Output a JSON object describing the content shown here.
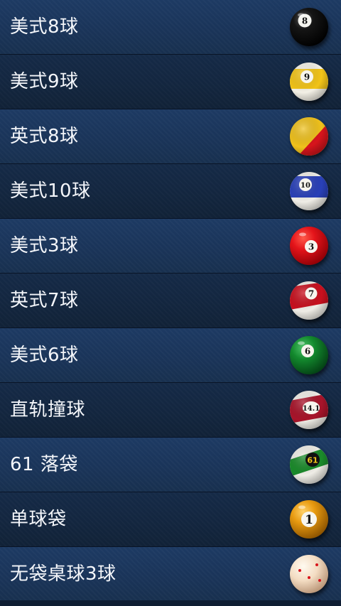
{
  "game_list": [
    {
      "label": "美式8球",
      "icon": "eight-ball-icon"
    },
    {
      "label": "美式9球",
      "icon": "nine-ball-icon"
    },
    {
      "label": "英式8球",
      "icon": "english-eight-ball-icon"
    },
    {
      "label": "美式10球",
      "icon": "ten-ball-icon"
    },
    {
      "label": "美式3球",
      "icon": "three-ball-icon"
    },
    {
      "label": "英式7球",
      "icon": "seven-ball-icon"
    },
    {
      "label": "美式6球",
      "icon": "six-ball-icon"
    },
    {
      "label": "直轨撞球",
      "icon": "straight-pool-ball-icon"
    },
    {
      "label": "61 落袋",
      "icon": "sixty-one-ball-icon"
    },
    {
      "label": "单球袋",
      "icon": "one-pocket-ball-icon"
    },
    {
      "label": "无袋桌球3球",
      "icon": "carom-cue-ball-icon"
    }
  ],
  "ball_numbers": {
    "eight": "8",
    "nine": "9",
    "ten": "10",
    "three": "3",
    "seven": "7",
    "six": "6",
    "straight": "14.1",
    "sixtyone": "61",
    "one": "1"
  },
  "colors": {
    "row_light": "#1a3459",
    "row_dark": "#13263f",
    "text": "#f4f6fa"
  }
}
